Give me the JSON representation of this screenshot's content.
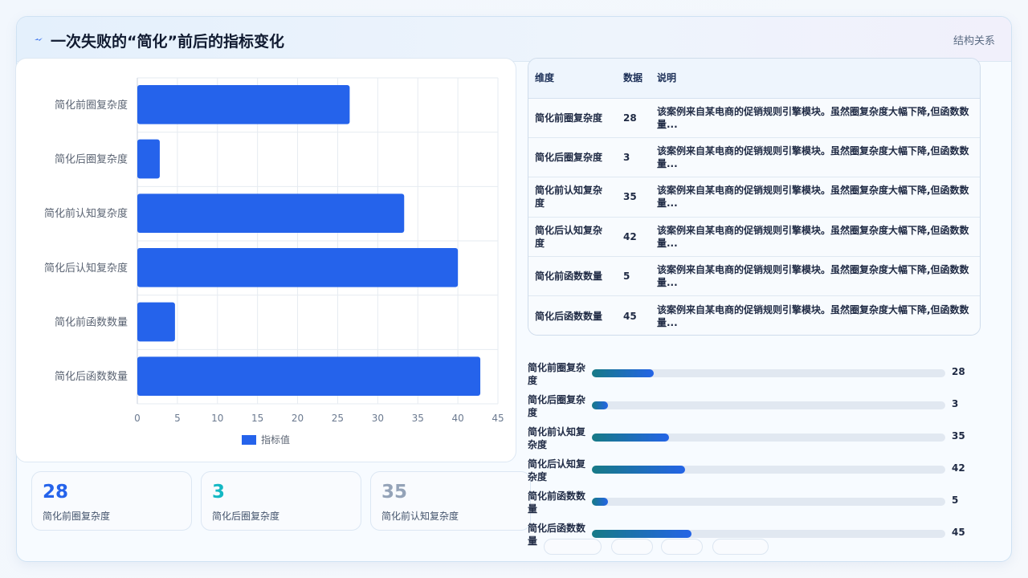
{
  "header": {
    "title": "一次失败的“简化”前后的指标变化",
    "right_label": "结构关系",
    "icon": "lightning-icon"
  },
  "chart_data": {
    "type": "bar",
    "orientation": "horizontal",
    "categories": [
      "简化前圈复杂度",
      "简化后圈复杂度",
      "简化前认知复杂度",
      "简化后认知复杂度",
      "简化前函数数量",
      "简化后函数数量"
    ],
    "series": [
      {
        "name": "指标值",
        "values": [
          26.5,
          2.8,
          33.3,
          40,
          4.7,
          42.8
        ]
      }
    ],
    "xlim": [
      0,
      45
    ],
    "xticks": [
      0,
      5,
      10,
      15,
      20,
      25,
      30,
      35,
      40,
      45
    ],
    "grid": true,
    "legend": "bottom",
    "bar_color": "#2563eb"
  },
  "stats": [
    {
      "value": "28",
      "label": "简化前圈复杂度",
      "color": "#2563eb"
    },
    {
      "value": "3",
      "label": "简化后圈复杂度",
      "color": "#14b8c4"
    },
    {
      "value": "35",
      "label": "简化前认知复杂度",
      "color": "#94a3b8"
    }
  ],
  "table": {
    "headers": [
      "维度",
      "数据",
      "说明"
    ],
    "rows": [
      {
        "dim": "简化前圈复杂度",
        "val": "28",
        "desc": "该案例来自某电商的促销规则引擎模块。虽然圈复杂度大幅下降,但函数数量..."
      },
      {
        "dim": "简化后圈复杂度",
        "val": "3",
        "desc": "该案例来自某电商的促销规则引擎模块。虽然圈复杂度大幅下降,但函数数量..."
      },
      {
        "dim": "简化前认知复杂度",
        "val": "35",
        "desc": "该案例来自某电商的促销规则引擎模块。虽然圈复杂度大幅下降,但函数数量..."
      },
      {
        "dim": "简化后认知复杂度",
        "val": "42",
        "desc": "该案例来自某电商的促销规则引擎模块。虽然圈复杂度大幅下降,但函数数量..."
      },
      {
        "dim": "简化前函数数量",
        "val": "5",
        "desc": "该案例来自某电商的促销规则引擎模块。虽然圈复杂度大幅下降,但函数数量..."
      },
      {
        "dim": "简化后函数数量",
        "val": "45",
        "desc": "该案例来自某电商的促销规则引擎模块。虽然圈复杂度大幅下降,但函数数量..."
      }
    ]
  },
  "progress": {
    "max": 160,
    "items": [
      {
        "label": "简化前圈复杂度",
        "value": 28
      },
      {
        "label": "简化后圈复杂度",
        "value": 3
      },
      {
        "label": "简化前认知复杂度",
        "value": 35
      },
      {
        "label": "简化后认知复杂度",
        "value": 42
      },
      {
        "label": "简化前函数数量",
        "value": 5
      },
      {
        "label": "简化后函数数量",
        "value": 45
      }
    ]
  }
}
